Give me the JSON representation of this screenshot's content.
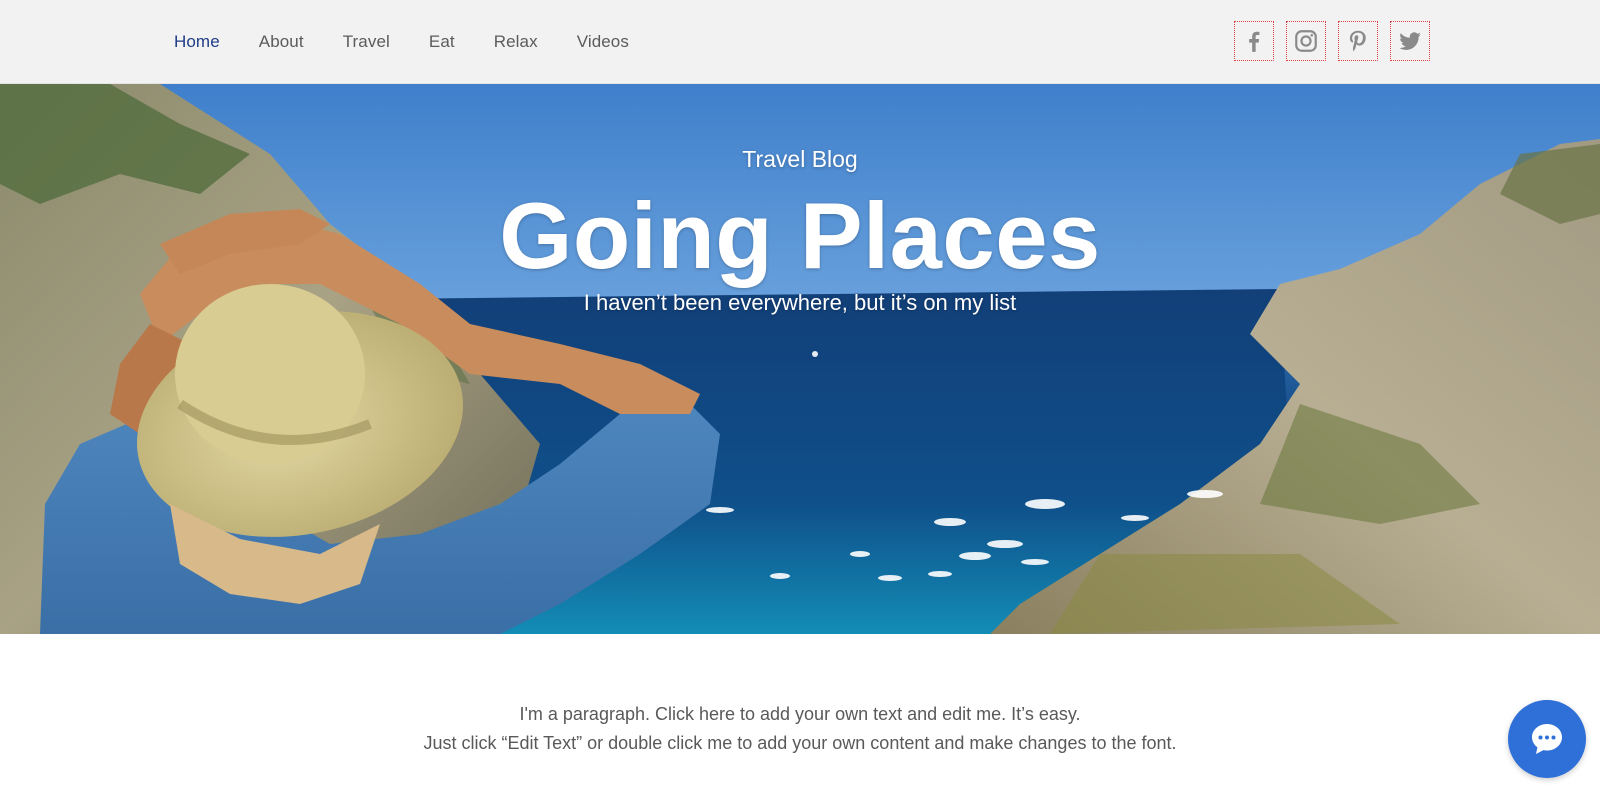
{
  "nav": {
    "items": [
      {
        "label": "Home",
        "active": true
      },
      {
        "label": "About",
        "active": false
      },
      {
        "label": "Travel",
        "active": false
      },
      {
        "label": "Eat",
        "active": false
      },
      {
        "label": "Relax",
        "active": false
      },
      {
        "label": "Videos",
        "active": false
      }
    ]
  },
  "social": {
    "icons": [
      "facebook-icon",
      "instagram-icon",
      "pinterest-icon",
      "twitter-icon"
    ]
  },
  "hero": {
    "kicker": "Travel Blog",
    "title": "Going Places",
    "subtitle": "I haven’t been everywhere, but it’s on my list"
  },
  "content": {
    "line1": "I'm a paragraph. Click here to add your own text and edit me. It’s easy.",
    "line2": "Just click “Edit Text” or double click me to add your own content and make changes to the font."
  },
  "chat": {
    "icon": "chat-bubble-icon"
  },
  "colors": {
    "nav_active": "#1f3c86",
    "nav_text": "#5b5b5b",
    "header_bg": "#f2f2f3",
    "chat_button": "#2e6fd8",
    "social_icon": "#8a8a8a"
  }
}
